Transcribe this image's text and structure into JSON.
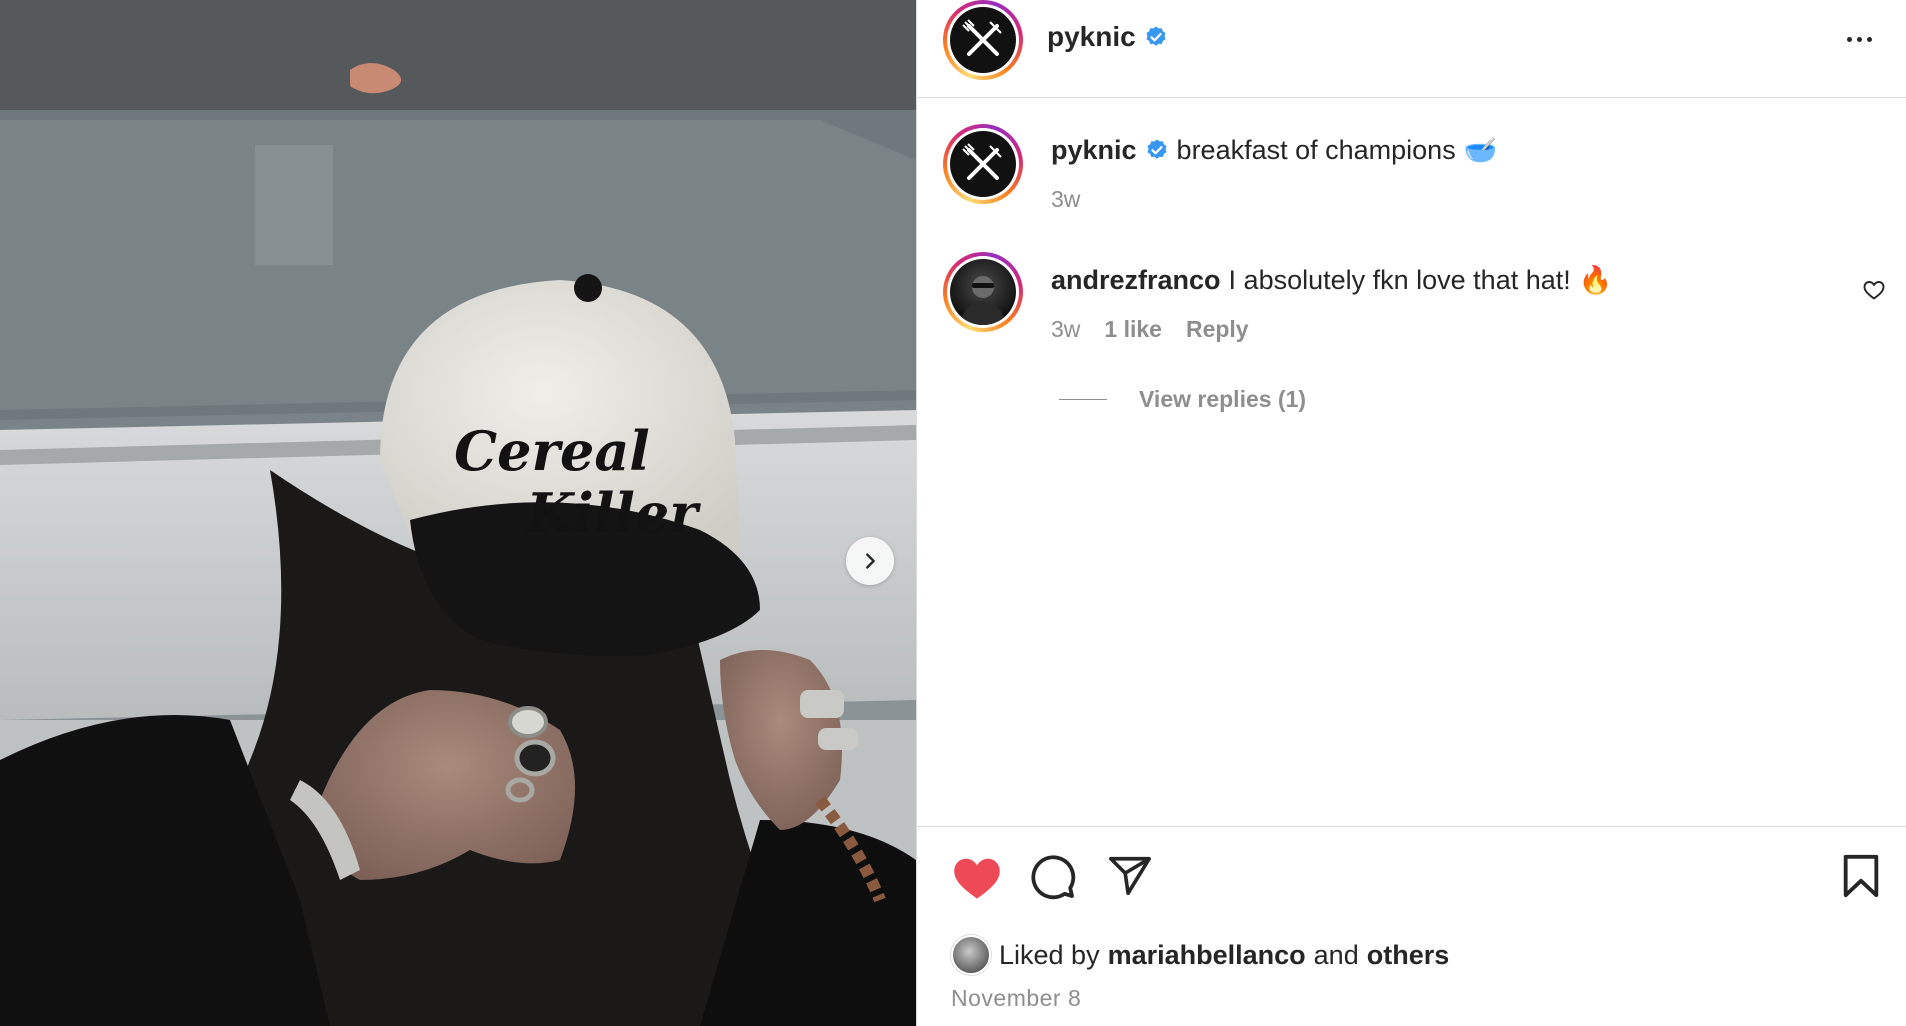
{
  "post": {
    "image_alt": "Person with long dark hair pulling down the brim of a white and black snapback cap embroidered with Cereal Killer, wearing silver rings and bracelets, in front of a car",
    "hat_text_line1": "Cereal",
    "hat_text_line2": "Killer",
    "next_icon": "chevron-right-icon"
  },
  "header": {
    "username": "pyknic",
    "verified_icon": "verified-badge-icon",
    "more_icon": "more-horizontal-icon"
  },
  "caption": {
    "username": "pyknic",
    "text": "breakfast of champions",
    "emoji": "🥣",
    "time": "3w"
  },
  "comment": {
    "username": "andrezfranco",
    "text": "I absolutely fkn love that hat!",
    "emoji": "🔥",
    "time": "3w",
    "likes": "1 like",
    "reply_label": "Reply",
    "view_replies": "View replies (1)"
  },
  "actions": {
    "liked_icon": "heart-filled-icon",
    "comment_icon": "comment-icon",
    "share_icon": "share-icon",
    "save_icon": "bookmark-icon"
  },
  "likes": {
    "prefix": "Liked by",
    "user": "mariahbellanco",
    "conj": "and",
    "others": "others"
  },
  "date": "November 8",
  "colors": {
    "liked_red": "#ed4956",
    "verified_blue": "#3897f0",
    "muted_text": "#8e8e8e",
    "text": "#262626",
    "divider": "#dbdbdb"
  }
}
